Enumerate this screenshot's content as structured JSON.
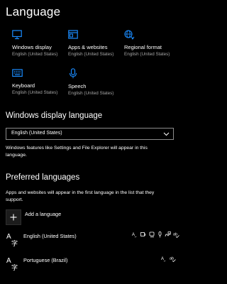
{
  "page": {
    "title": "Language"
  },
  "tiles": [
    {
      "label": "Windows display",
      "sublabel": "English (United States)",
      "icon": "monitor-icon"
    },
    {
      "label": "Apps & websites",
      "sublabel": "English (United States)",
      "icon": "app-window-icon"
    },
    {
      "label": "Regional format",
      "sublabel": "English (United States)",
      "icon": "globe-icon"
    },
    {
      "label": "Keyboard",
      "sublabel": "English (United States)",
      "icon": "keyboard-icon"
    },
    {
      "label": "Speech",
      "sublabel": "English (United States)",
      "icon": "microphone-icon"
    }
  ],
  "display_language": {
    "heading": "Windows display language",
    "selected": "English (United States)",
    "description": [
      "Windows features like Settings and File Explorer will appear in this",
      "language."
    ]
  },
  "preferred": {
    "heading": "Preferred languages",
    "description": [
      "Apps and websites will appear in the first language in the list that they",
      "support."
    ],
    "add_label": "Add a language",
    "languages": [
      {
        "name": "English (United States)",
        "features": [
          "display-language-icon",
          "text-to-speech-icon",
          "speech-recognition-icon",
          "handwriting-icon",
          "spellcheck-icon"
        ]
      },
      {
        "name": "Portuguese (Brazil)",
        "features": [
          "display-language-icon",
          "spellcheck-icon"
        ]
      }
    ]
  },
  "colors": {
    "accent": "#1a8cff",
    "background": "#000000",
    "secondary_text": "#a6a6a6"
  }
}
